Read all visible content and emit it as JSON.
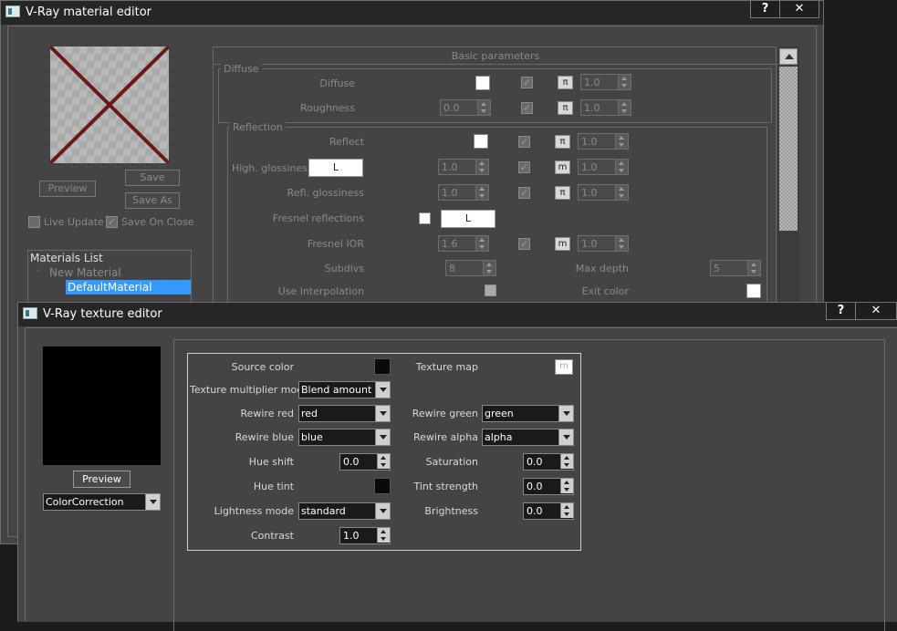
{
  "material_editor": {
    "title": "V-Ray material editor",
    "help_label": "?",
    "close_label": "✕",
    "preview_label": "Preview",
    "save_label": "Save",
    "save_as_label": "Save As",
    "live_update_label": "Live Update",
    "save_on_close_label": "Save On Close",
    "materials_list_label": "Materials List",
    "new_material_label": "New Material",
    "selected_material": "DefaultMaterial",
    "rollout_title": "Basic parameters",
    "diffuse_group": "Diffuse",
    "diffuse_label": "Diffuse",
    "roughness_label": "Roughness",
    "roughness_value": "0.0",
    "diffuse_tex_value": "1.0",
    "roughness_tex_value": "1.0",
    "reflection_group": "Reflection",
    "reflect_label": "Reflect",
    "reflect_tex_value": "1.0",
    "high_gloss_label": "High. glossiness",
    "high_gloss_btn": "L",
    "high_gloss_value": "1.0",
    "high_gloss_tex_value": "1.0",
    "refl_gloss_label": "Refl. glossiness",
    "refl_gloss_value": "1.0",
    "refl_gloss_tex_value": "1.0",
    "fresnel_label": "Fresnel reflections",
    "fresnel_btn": "L",
    "fresnel_ior_label": "Fresnel IOR",
    "fresnel_ior_value": "1.6",
    "fresnel_ior_tex_value": "1.0",
    "subdivs_label": "Subdivs",
    "subdivs_value": "8",
    "max_depth_label": "Max depth",
    "max_depth_value": "5",
    "use_interp_label": "Use interpolation",
    "exit_color_label": "Exit color",
    "map_label": "m",
    "map_label_alt": "π"
  },
  "texture_editor": {
    "title": "V-Ray texture editor",
    "help_label": "?",
    "close_label": "✕",
    "preview_label": "Preview",
    "texture_type": "ColorCorrection",
    "source_color_label": "Source color",
    "texture_map_label": "Texture map",
    "texture_map_btn": "m",
    "tex_mult_mode_label": "Texture multiplier mode",
    "tex_mult_mode_value": "Blend amount",
    "rewire_red_label": "Rewire red",
    "rewire_red_value": "red",
    "rewire_green_label": "Rewire green",
    "rewire_green_value": "green",
    "rewire_blue_label": "Rewire blue",
    "rewire_blue_value": "blue",
    "rewire_alpha_label": "Rewire alpha",
    "rewire_alpha_value": "alpha",
    "hue_shift_label": "Hue shift",
    "hue_shift_value": "0.0",
    "saturation_label": "Saturation",
    "saturation_value": "0.0",
    "hue_tint_label": "Hue tint",
    "tint_strength_label": "Tint strength",
    "tint_strength_value": "0.0",
    "lightness_mode_label": "Lightness mode",
    "lightness_mode_value": "standard",
    "brightness_label": "Brightness",
    "brightness_value": "0.0",
    "contrast_label": "Contrast",
    "contrast_value": "1.0"
  },
  "colors": {
    "selection": "#3399ff",
    "window_bg": "#444444",
    "title_bg": "#262626"
  }
}
